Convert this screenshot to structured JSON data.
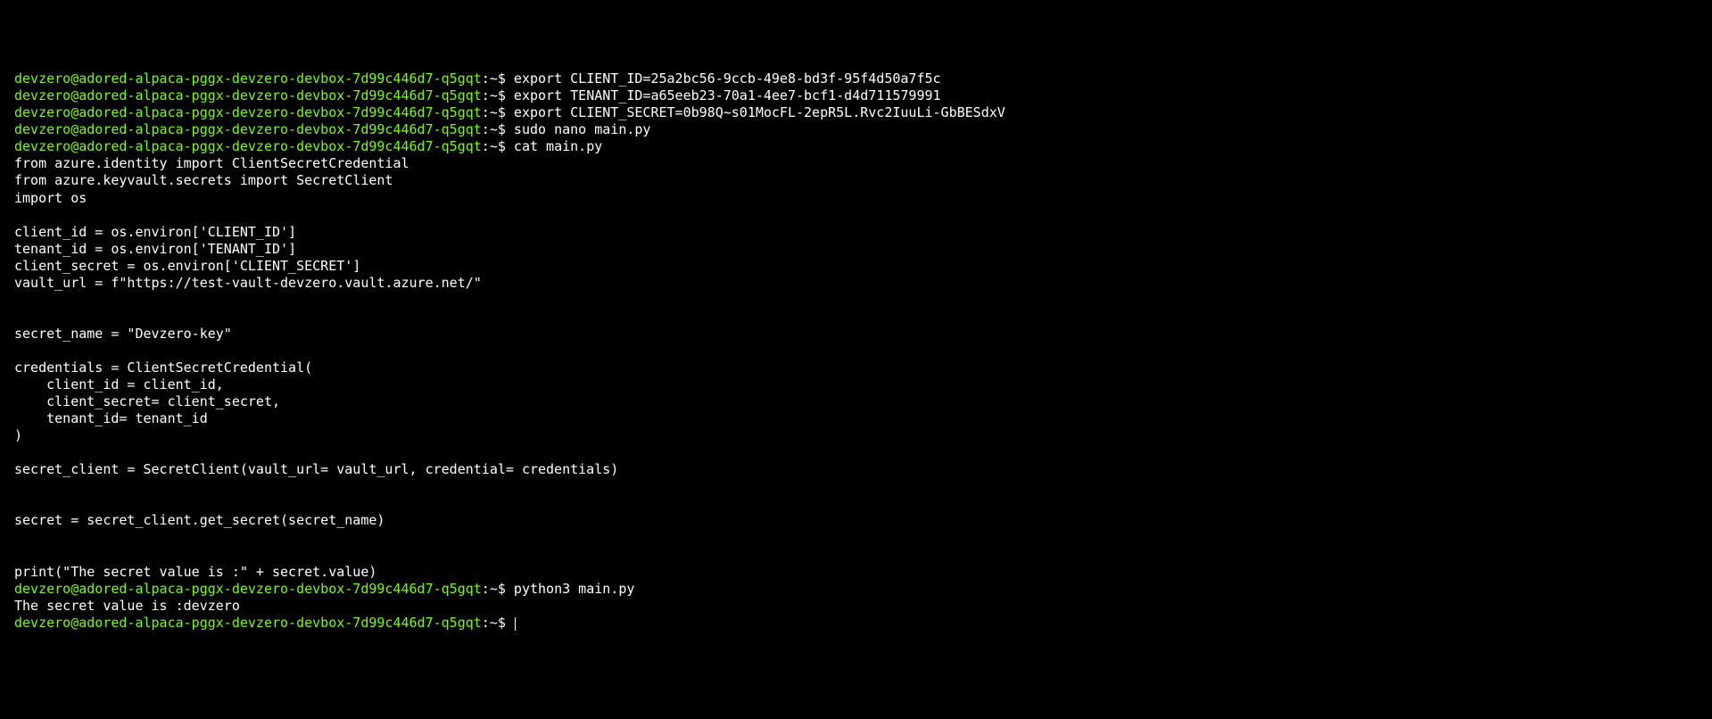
{
  "prompt": {
    "user_host": "devzero@adored-alpaca-pggx-devzero-devbox-7d99c446d7-q5gqt",
    "path": ":~",
    "symbol": "$ "
  },
  "lines": [
    {
      "type": "command",
      "cmd": "export CLIENT_ID=25a2bc56-9ccb-49e8-bd3f-95f4d50a7f5c"
    },
    {
      "type": "command",
      "cmd": "export TENANT_ID=a65eeb23-70a1-4ee7-bcf1-d4d711579991"
    },
    {
      "type": "command",
      "cmd": "export CLIENT_SECRET=0b98Q~s01MocFL-2epR5L.Rvc2IuuLi-GbBESdxV"
    },
    {
      "type": "command",
      "cmd": "sudo nano main.py"
    },
    {
      "type": "command",
      "cmd": "cat main.py"
    },
    {
      "type": "output",
      "text": "from azure.identity import ClientSecretCredential"
    },
    {
      "type": "output",
      "text": "from azure.keyvault.secrets import SecretClient"
    },
    {
      "type": "output",
      "text": "import os"
    },
    {
      "type": "output",
      "text": ""
    },
    {
      "type": "output",
      "text": "client_id = os.environ['CLIENT_ID']"
    },
    {
      "type": "output",
      "text": "tenant_id = os.environ['TENANT_ID']"
    },
    {
      "type": "output",
      "text": "client_secret = os.environ['CLIENT_SECRET']"
    },
    {
      "type": "output",
      "text": "vault_url = f\"https://test-vault-devzero.vault.azure.net/\""
    },
    {
      "type": "output",
      "text": ""
    },
    {
      "type": "output",
      "text": ""
    },
    {
      "type": "output",
      "text": "secret_name = \"Devzero-key\""
    },
    {
      "type": "output",
      "text": ""
    },
    {
      "type": "output",
      "text": "credentials = ClientSecretCredential("
    },
    {
      "type": "output",
      "text": "    client_id = client_id,"
    },
    {
      "type": "output",
      "text": "    client_secret= client_secret,"
    },
    {
      "type": "output",
      "text": "    tenant_id= tenant_id"
    },
    {
      "type": "output",
      "text": ")"
    },
    {
      "type": "output",
      "text": ""
    },
    {
      "type": "output",
      "text": "secret_client = SecretClient(vault_url= vault_url, credential= credentials)"
    },
    {
      "type": "output",
      "text": ""
    },
    {
      "type": "output",
      "text": ""
    },
    {
      "type": "output",
      "text": "secret = secret_client.get_secret(secret_name)"
    },
    {
      "type": "output",
      "text": ""
    },
    {
      "type": "output",
      "text": ""
    },
    {
      "type": "output",
      "text": "print(\"The secret value is :\" + secret.value)"
    },
    {
      "type": "command",
      "cmd": "python3 main.py"
    },
    {
      "type": "output",
      "text": "The secret value is :devzero"
    },
    {
      "type": "command",
      "cmd": "",
      "cursor": true
    }
  ]
}
